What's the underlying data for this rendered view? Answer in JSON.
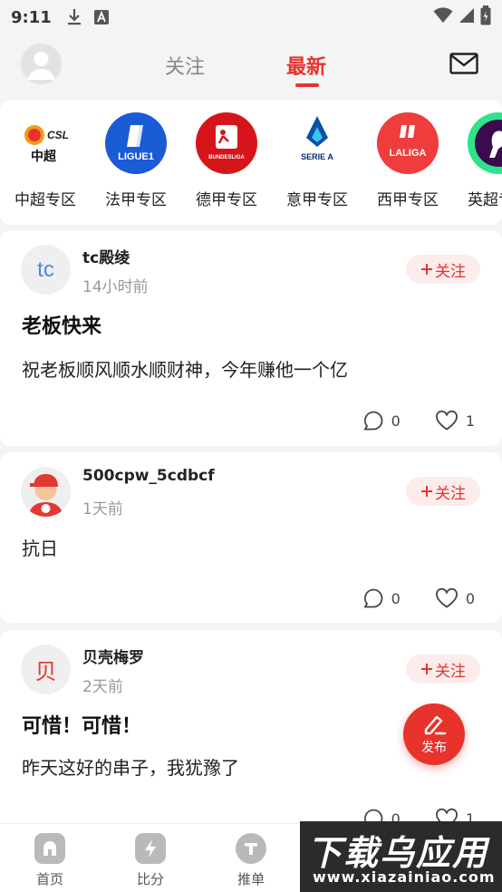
{
  "status_bar": {
    "time": "9:11",
    "icons": [
      "download-icon",
      "a-icon",
      "wifi-icon",
      "signal-icon",
      "battery-icon"
    ]
  },
  "top_nav": {
    "tabs": [
      {
        "label": "关注",
        "active": false
      },
      {
        "label": "最新",
        "active": true
      }
    ]
  },
  "leagues": [
    {
      "logo_text": "中超",
      "logo_sub": "CSL",
      "label": "中超专区",
      "color": "#e8332d"
    },
    {
      "logo_text": "LIGUE1",
      "label": "法甲专区",
      "color": "#1a5bd6"
    },
    {
      "logo_text": "BUNDESLIGA",
      "label": "德甲专区",
      "color": "#d6151b"
    },
    {
      "logo_text": "SERIE A",
      "label": "意甲专区",
      "color": "#0b4fa8"
    },
    {
      "logo_text": "LALIGA",
      "label": "西甲专区",
      "color": "#ef3c3c"
    },
    {
      "logo_text": "",
      "label": "英超专区",
      "color": "#3d0a4e"
    }
  ],
  "posts": [
    {
      "avatar_text": "tc",
      "author": "tc殿绫",
      "time": "14小时前",
      "follow_label": "关注",
      "title": "老板快来",
      "body": "祝老板顺风顺水顺财神，今年赚他一个亿",
      "comments": "0",
      "likes": "1"
    },
    {
      "avatar_text": "",
      "author": "500cpw_5cdbcf",
      "time": "1天前",
      "follow_label": "关注",
      "title": "",
      "body": "抗日",
      "comments": "0",
      "likes": "0"
    },
    {
      "avatar_text": "贝",
      "author": "贝壳梅罗",
      "time": "2天前",
      "follow_label": "关注",
      "title": "可惜！可惜！",
      "body": "昨天这好的串子，我犹豫了",
      "comments": "0",
      "likes": "1"
    }
  ],
  "fab": {
    "label": "发布"
  },
  "bottom_nav": [
    {
      "label": "首页",
      "icon": "home-icon"
    },
    {
      "label": "比分",
      "icon": "lightning-icon"
    },
    {
      "label": "推单",
      "icon": "t-icon"
    }
  ],
  "watermark": {
    "big": "下载乌应用",
    "small": "www.xiazainiao.com"
  },
  "colors": {
    "accent": "#e8332d",
    "follow_bg": "#fdecec",
    "muted": "#999999"
  }
}
